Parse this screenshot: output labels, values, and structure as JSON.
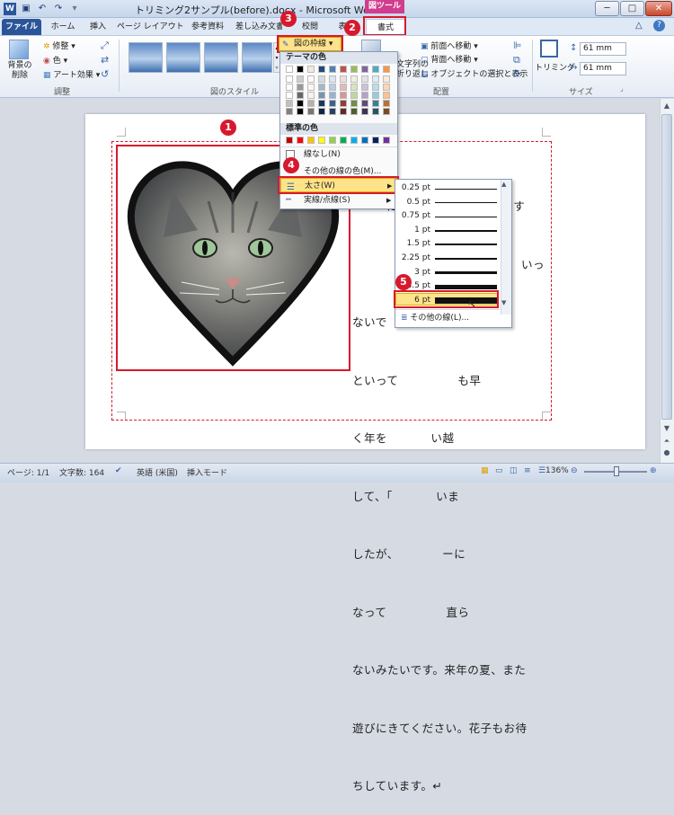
{
  "window": {
    "title": "トリミング2サンプル(before).docx - Microsoft Word",
    "app_icon": "W",
    "contextual_tab_title": "図ツール",
    "controls": {
      "minimize": "─",
      "maximize": "□",
      "close": "✕"
    }
  },
  "quick_access": {
    "save": "save-icon",
    "undo": "undo-icon",
    "redo": "redo-icon"
  },
  "tabs": [
    {
      "label": "ファイル"
    },
    {
      "label": "ホーム"
    },
    {
      "label": "挿入"
    },
    {
      "label": "ページ レイアウト"
    },
    {
      "label": "参考資料"
    },
    {
      "label": "差し込み文書"
    },
    {
      "label": "校閲"
    },
    {
      "label": "表"
    },
    {
      "label": "書式"
    }
  ],
  "ribbon": {
    "remove_bg": "背景の\n削除",
    "correction": "修整",
    "color": "色",
    "art_effects": "アート効果",
    "group_adjust": "調整",
    "group_styles": "図のスタイル",
    "picture_border": "図の枠線",
    "bring_forward": "前面へ移動",
    "send_backward": "背面へ移動",
    "selection_pane": "オブジェクトの選択と表示",
    "wrap_text": "文字列の\n折り返し",
    "group_arrange": "配置",
    "crop": "トリミング",
    "height": "61 mm",
    "width": "61 mm",
    "group_size": "サイズ"
  },
  "border_menu": {
    "theme_colors_header": "テーマの色",
    "standard_colors_header": "標準の色",
    "no_outline": "線なし(N)",
    "more_colors": "その他の線の色(M)...",
    "weight": "太さ(W)",
    "dashes": "実線/点線(S)",
    "theme_top_row": [
      "#ffffff",
      "#000000",
      "#eeece1",
      "#1f497d",
      "#4f81bd",
      "#c0504d",
      "#9bbb59",
      "#8064a2",
      "#4bacc6",
      "#f79646"
    ],
    "standard_colors": [
      "#c00000",
      "#ff0000",
      "#ffc000",
      "#ffff00",
      "#92d050",
      "#00b050",
      "#00b0f0",
      "#0070c0",
      "#002060",
      "#7030a0"
    ]
  },
  "weight_menu": {
    "weights": [
      "0.25 pt",
      "0.5 pt",
      "0.75 pt",
      "1 pt",
      "1.5 pt",
      "2.25 pt",
      "3 pt",
      "4.5 pt",
      "6 pt"
    ],
    "more_lines": "その他の線(L)..."
  },
  "document": {
    "text_lines": [
      "にしています。お元気です",
      "いっ",
      "ないで                   す。",
      "といって               も早",
      "く年を           い越",
      "して、「           いま",
      "したが、           ーに",
      "なって               直ら",
      "ないみたいです。来年の夏、また",
      "遊びにきてください。花子もお待",
      "ちしています。↵"
    ]
  },
  "status": {
    "page": "ページ: 1/1",
    "words": "文字数: 164",
    "language": "英語 (米国)",
    "mode": "挿入モード",
    "zoom": "136%"
  },
  "callouts": [
    "1",
    "2",
    "3",
    "4",
    "5"
  ],
  "colors": {
    "callout_red": "#d7192d",
    "menu_highlight": "#ffe38a",
    "file_tab": "#2a5699",
    "tools_tab": "#d23c8e"
  }
}
